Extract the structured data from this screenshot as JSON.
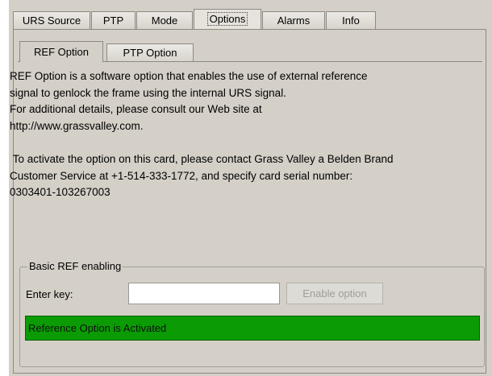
{
  "tabs": [
    {
      "label": "URS Source"
    },
    {
      "label": "PTP"
    },
    {
      "label": "Mode"
    },
    {
      "label": "Options"
    },
    {
      "label": "Alarms"
    },
    {
      "label": "Info"
    }
  ],
  "active_tab": "Options",
  "subtabs": [
    {
      "label": "REF Option"
    },
    {
      "label": "PTP Option"
    }
  ],
  "active_subtab": "REF Option",
  "description": "REF Option is a software option that enables the use of external reference\nsignal to genlock the frame using the internal URS signal.\nFor additional details, please consult our Web site at\nhttp://www.grassvalley.com.\n\n To activate the option on this card, please contact Grass Valley a Belden Brand\nCustomer Service at +1-514-333-1772, and specify card serial number:\n0303401-103267003",
  "group": {
    "title": "Basic REF enabling",
    "key_label": "Enter key:",
    "key_value": "",
    "enable_button": "Enable option",
    "status": "Reference Option is Activated"
  },
  "colors": {
    "panel": "#d4d0c8",
    "status_ok": "#0b9b05",
    "disabled_text": "#a09d96"
  }
}
